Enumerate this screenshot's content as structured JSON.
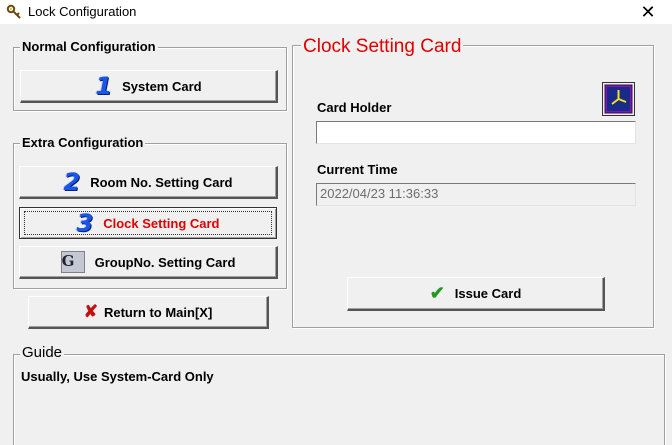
{
  "window": {
    "title": "Lock Configuration",
    "close_glyph": "✕",
    "icon": "lock-key-icon"
  },
  "normal_config": {
    "legend": "Normal Configuration",
    "system_card_label": "System Card",
    "system_card_icon_text": "1"
  },
  "extra_config": {
    "legend": "Extra Configuration",
    "room_label": "Room No. Setting Card",
    "room_icon_text": "2",
    "clock_label": "Clock Setting Card",
    "clock_icon_text": "3",
    "group_label": "GroupNo. Setting Card",
    "group_icon_text": "G"
  },
  "return_button": {
    "label": "Return to Main[X]",
    "icon_glyph": "✘"
  },
  "clock_panel": {
    "title": "Clock Setting Card",
    "card_holder_label": "Card Holder",
    "card_holder_value": "",
    "current_time_label": "Current Time",
    "current_time_value": "2022/04/23 11:36:33",
    "issue_label": "Issue Card",
    "issue_icon_glyph": "✔",
    "clock_icon": "clock-icon"
  },
  "guide": {
    "legend": "Guide",
    "text": "Usually, Use System-Card Only"
  },
  "colors": {
    "accent_red": "#e00000",
    "number_blue": "#1a56e8",
    "check_green": "#1e9a1e",
    "clock_purple": "#7a1aa8"
  }
}
